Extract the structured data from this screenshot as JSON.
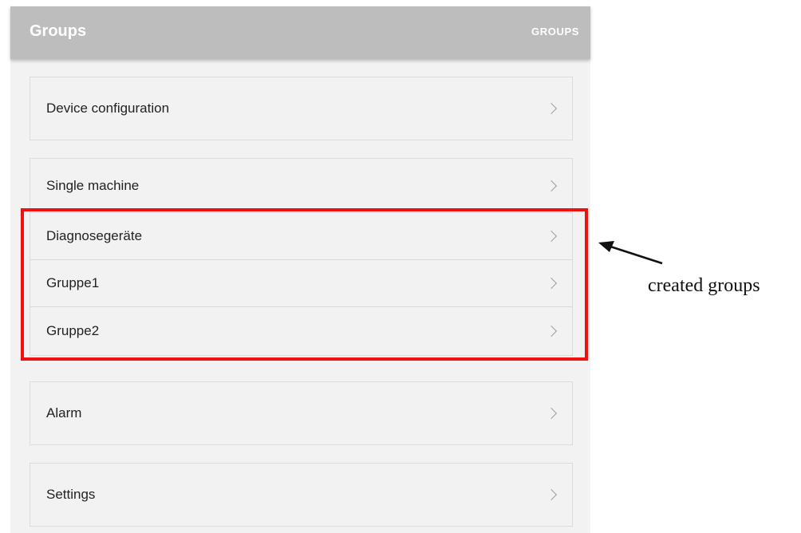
{
  "header": {
    "title": "Groups",
    "action_label": "GROUPS"
  },
  "cards": [
    {
      "label": "Device configuration"
    },
    {
      "label": "Single machine",
      "subitems": [
        "Diagnosegeräte",
        "Gruppe1",
        "Gruppe2"
      ]
    },
    {
      "label": "Alarm"
    },
    {
      "label": "Settings"
    }
  ],
  "annotation": {
    "text": "created groups",
    "highlight_color": "#ee1111"
  },
  "icons": {
    "chevron": "chevron-right-icon"
  }
}
